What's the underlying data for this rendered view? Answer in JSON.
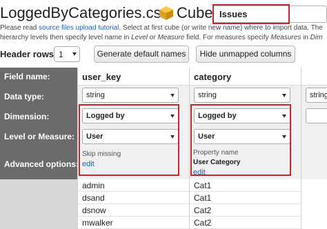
{
  "header": {
    "file_title": "LoggedByCategories.csv",
    "cube_label": "Cube:",
    "cube_value": "Issues"
  },
  "info": {
    "line1_prefix": "Please read ",
    "line1_link": "source files upload tutorial",
    "line1_suffix": ". Select at first cube (or write new name) where to import data. The",
    "line2_prefix": "hierarchy levels then specify level name in ",
    "line2_italic1": "Level or Measure",
    "line2_mid": " field. For measures specify ",
    "line2_italic2": "Measures",
    "line2_mid2": " in ",
    "line2_italic3": "Dim"
  },
  "controls": {
    "header_rows_label": "Header rows",
    "header_rows_value": "1",
    "generate_button": "Generate default names",
    "hide_button": "Hide unmapped columns"
  },
  "row_labels": {
    "field_name": "Field name:",
    "data_type": "Data type:",
    "dimension": "Dimension:",
    "level_or_measure": "Level or Measure:",
    "advanced_options": "Advanced options:"
  },
  "columns": [
    {
      "field_name": "user_key",
      "data_type": "string",
      "dimension": "Logged by",
      "level_or_measure": "User",
      "adv_label": "Skip missing",
      "adv_value": "",
      "adv_link": "edit",
      "values": [
        "admin",
        "dsand",
        "dsnow",
        "mwalker"
      ]
    },
    {
      "field_name": "category",
      "data_type": "string",
      "dimension": "Logged by",
      "level_or_measure": "User",
      "adv_label": "Property name",
      "adv_value": "User Category",
      "adv_link": "edit",
      "values": [
        "Cat1",
        "Cat1",
        "Cat2",
        "Cat2"
      ]
    },
    {
      "data_type": "string"
    }
  ],
  "colors": {
    "highlight": "#c0282c",
    "row_label_bg": "#6b6b6b",
    "link": "#1a5fb4"
  }
}
